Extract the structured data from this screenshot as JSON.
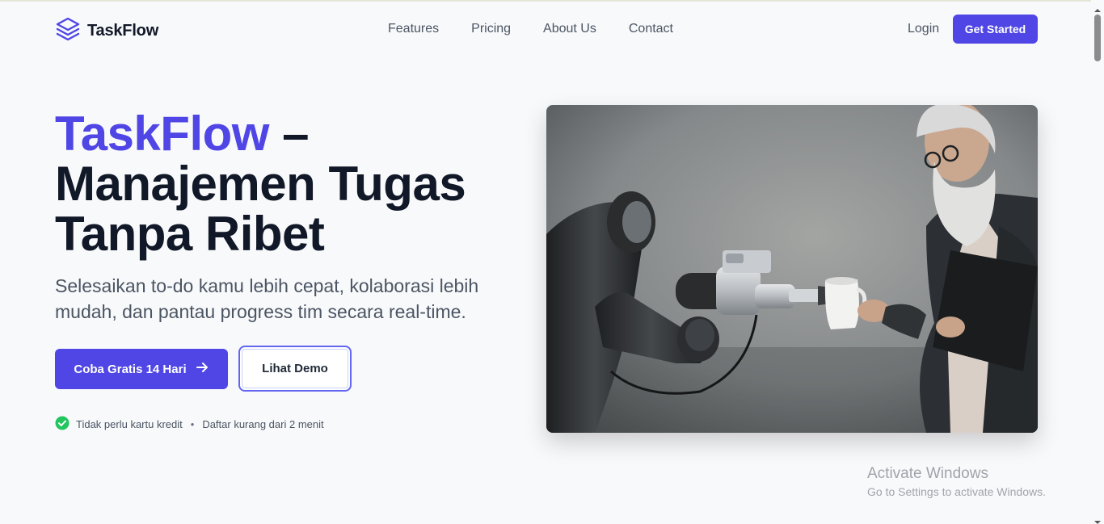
{
  "header": {
    "brand": "TaskFlow",
    "nav": [
      "Features",
      "Pricing",
      "About Us",
      "Contact"
    ],
    "login": "Login",
    "cta": "Get Started"
  },
  "hero": {
    "title_accent": "TaskFlow",
    "title_rest": " – Manajemen Tugas Tanpa Ribet",
    "subtitle": "Selesaikan to-do kamu lebih cepat, kolaborasi lebih mudah, dan pantau progress tim secara real-time.",
    "primary_button": "Coba Gratis 14 Hari",
    "secondary_button": "Lihat Demo",
    "note_1": "Tidak perlu kartu kredit",
    "note_sep": "•",
    "note_2": "Daftar kurang dari 2 menit"
  },
  "watermark": {
    "title": "Activate Windows",
    "subtitle": "Go to Settings to activate Windows."
  },
  "colors": {
    "accent": "#4f46e5",
    "success": "#22c55e",
    "background": "#f8f9fb"
  },
  "icons": [
    "layers-icon",
    "arrow-right-icon",
    "check-circle-icon"
  ]
}
